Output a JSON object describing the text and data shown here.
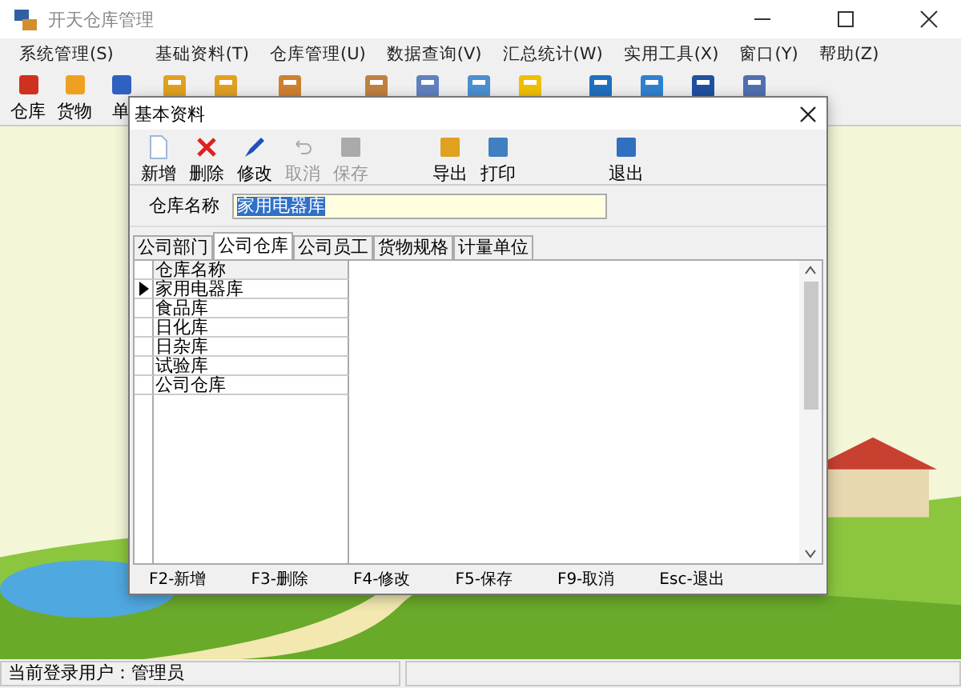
{
  "window": {
    "title": "开天仓库管理"
  },
  "menu": [
    "系统管理(S)",
    "基础资料(T)",
    "仓库管理(U)",
    "数据查询(V)",
    "汇总统计(W)",
    "实用工具(X)",
    "窗口(Y)",
    "帮助(Z)"
  ],
  "toolbar": [
    {
      "label": "仓库",
      "kind": "warehouse"
    },
    {
      "label": "货物",
      "kind": "goods"
    },
    {
      "label": "单",
      "kind": "people"
    }
  ],
  "dialog": {
    "title": "基本资料",
    "toolbar": [
      {
        "label": "新增",
        "kind": "new",
        "disabled": false
      },
      {
        "label": "删除",
        "kind": "delete",
        "disabled": false
      },
      {
        "label": "修改",
        "kind": "edit",
        "disabled": false
      },
      {
        "label": "取消",
        "kind": "undo",
        "disabled": true
      },
      {
        "label": "保存",
        "kind": "save",
        "disabled": true
      },
      {
        "label": "导出",
        "kind": "export",
        "disabled": false
      },
      {
        "label": "打印",
        "kind": "print",
        "disabled": false
      },
      {
        "label": "退出",
        "kind": "exit",
        "disabled": false
      }
    ],
    "field": {
      "label": "仓库名称",
      "value": "家用电器库"
    },
    "tabs": [
      {
        "label": "公司部门",
        "selected": false
      },
      {
        "label": "公司仓库",
        "selected": true
      },
      {
        "label": "公司员工",
        "selected": false
      },
      {
        "label": "货物规格",
        "selected": false
      },
      {
        "label": "计量单位",
        "selected": false
      }
    ],
    "table": {
      "columns": [
        "仓库名称"
      ],
      "rows": [
        {
          "name": "家用电器库",
          "selected": true
        },
        {
          "name": "食品库",
          "selected": false
        },
        {
          "name": "日化库",
          "selected": false
        },
        {
          "name": "日杂库",
          "selected": false
        },
        {
          "name": "试验库",
          "selected": false
        },
        {
          "name": "公司仓库",
          "selected": false
        }
      ]
    },
    "shortcuts": [
      "F2-新增",
      "F3-删除",
      "F4-修改",
      "F5-保存",
      "F9-取消",
      "Esc-退出"
    ]
  },
  "status_bar": {
    "user": "当前登录用户：管理员"
  }
}
